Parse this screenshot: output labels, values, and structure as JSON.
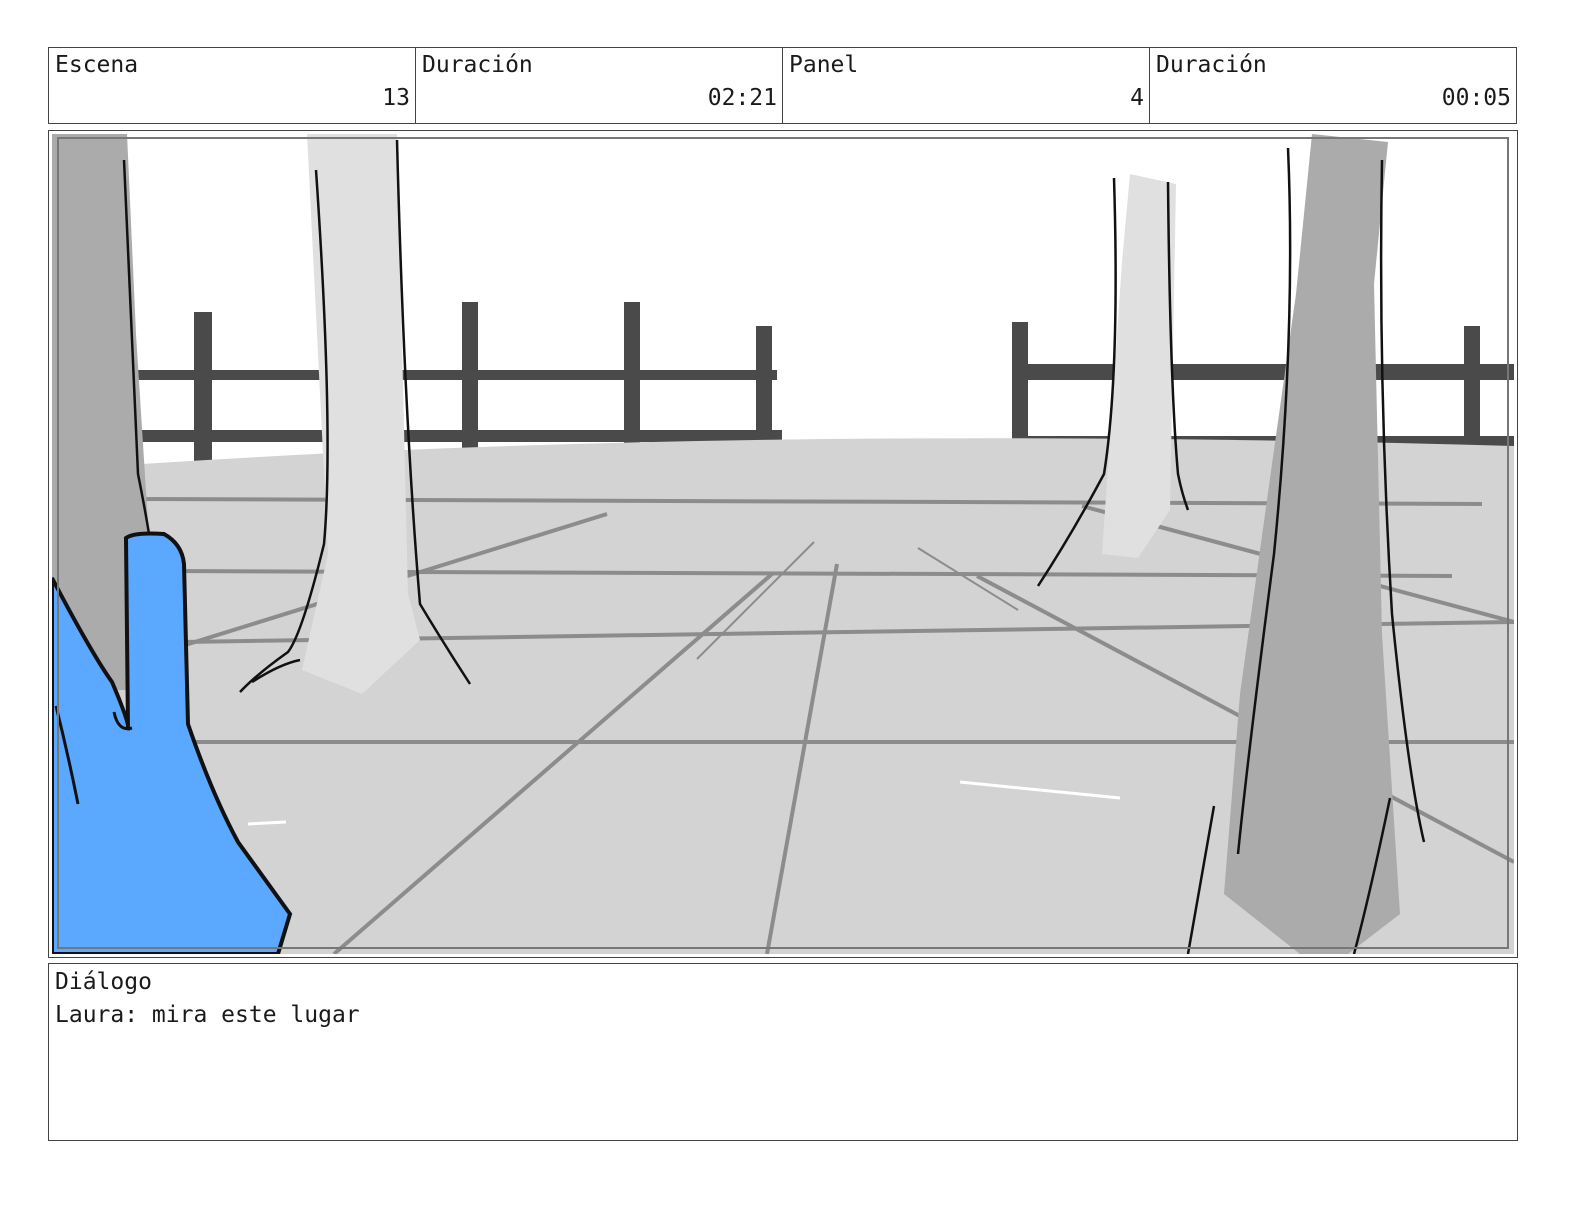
{
  "header": {
    "cells": [
      {
        "label": "Escena",
        "value": "13"
      },
      {
        "label": "Duración",
        "value": "02:21"
      },
      {
        "label": "Panel",
        "value": "4"
      },
      {
        "label": "Duración",
        "value": "00:05"
      }
    ]
  },
  "dialog": {
    "label": "Diálogo",
    "text": "Laura: mira este lugar"
  },
  "colors": {
    "character": "#5aa8ff",
    "ground": "#d3d3d3",
    "fence": "#4a4a4a",
    "tree_near": "#ababab",
    "tree_far": "#e0e0e0"
  }
}
